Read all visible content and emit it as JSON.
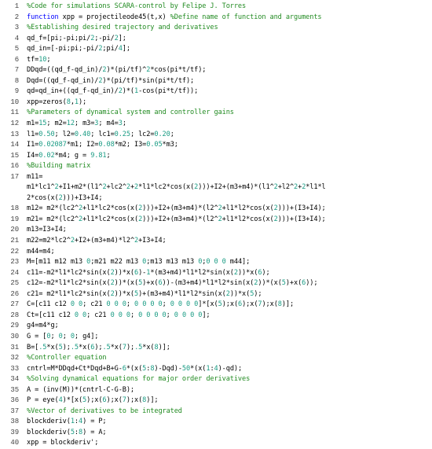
{
  "colors": {
    "comment": "#228B22",
    "keyword": "#0000FF",
    "number": "#1a9c84",
    "text": "#000000",
    "line_number": "#444444",
    "background": "#ffffff"
  },
  "lines": [
    {
      "n": "1",
      "segs": [
        {
          "t": "%Code for simulations SCARA-control by Felipe J. Torres",
          "c": "cmt"
        }
      ]
    },
    {
      "n": "2",
      "segs": [
        {
          "t": "function",
          "c": "kw"
        },
        {
          "t": " xpp = projectileode45(t,x) ",
          "c": "plain"
        },
        {
          "t": "%Define name of function and arguments",
          "c": "cmt"
        }
      ]
    },
    {
      "n": "3",
      "segs": [
        {
          "t": "%Establishing desired trajectory and derivatives",
          "c": "cmt"
        }
      ]
    },
    {
      "n": "4",
      "segs": [
        {
          "t": "qd_f=[pi;-pi;pi/",
          "c": "plain"
        },
        {
          "t": "2",
          "c": "num"
        },
        {
          "t": ";-pi/",
          "c": "plain"
        },
        {
          "t": "2",
          "c": "num"
        },
        {
          "t": "];",
          "c": "plain"
        }
      ]
    },
    {
      "n": "5",
      "segs": [
        {
          "t": "qd_in=[-pi;pi;-pi/",
          "c": "plain"
        },
        {
          "t": "2",
          "c": "num"
        },
        {
          "t": ";pi/",
          "c": "plain"
        },
        {
          "t": "4",
          "c": "num"
        },
        {
          "t": "];",
          "c": "plain"
        }
      ]
    },
    {
      "n": "6",
      "segs": [
        {
          "t": "tf=",
          "c": "plain"
        },
        {
          "t": "10",
          "c": "num"
        },
        {
          "t": ";",
          "c": "plain"
        }
      ]
    },
    {
      "n": "7",
      "segs": [
        {
          "t": "DDqd=((qd_f-qd_in)/",
          "c": "plain"
        },
        {
          "t": "2",
          "c": "num"
        },
        {
          "t": ")*(pi/tf)^",
          "c": "plain"
        },
        {
          "t": "2",
          "c": "num"
        },
        {
          "t": "*cos(pi*t/tf);",
          "c": "plain"
        }
      ]
    },
    {
      "n": "8",
      "segs": [
        {
          "t": "Dqd=((qd_f-qd_in)/",
          "c": "plain"
        },
        {
          "t": "2",
          "c": "num"
        },
        {
          "t": ")*(pi/tf)*sin(pi*t/tf);",
          "c": "plain"
        }
      ]
    },
    {
      "n": "9",
      "segs": [
        {
          "t": "qd=qd_in+((qd_f-qd_in)/",
          "c": "plain"
        },
        {
          "t": "2",
          "c": "num"
        },
        {
          "t": ")*(",
          "c": "plain"
        },
        {
          "t": "1",
          "c": "num"
        },
        {
          "t": "-cos(pi*t/tf));",
          "c": "plain"
        }
      ]
    },
    {
      "n": "10",
      "segs": [
        {
          "t": "xpp=zeros(",
          "c": "plain"
        },
        {
          "t": "8",
          "c": "num"
        },
        {
          "t": ",",
          "c": "plain"
        },
        {
          "t": "1",
          "c": "num"
        },
        {
          "t": ");",
          "c": "plain"
        }
      ]
    },
    {
      "n": "11",
      "segs": [
        {
          "t": "%Parameters of dynamical system and controller gains",
          "c": "cmt"
        }
      ]
    },
    {
      "n": "12",
      "segs": [
        {
          "t": "m1=",
          "c": "plain"
        },
        {
          "t": "15",
          "c": "num"
        },
        {
          "t": "; m2=",
          "c": "plain"
        },
        {
          "t": "12",
          "c": "num"
        },
        {
          "t": "; m3=",
          "c": "plain"
        },
        {
          "t": "3",
          "c": "num"
        },
        {
          "t": "; m4=",
          "c": "plain"
        },
        {
          "t": "3",
          "c": "num"
        },
        {
          "t": ";",
          "c": "plain"
        }
      ]
    },
    {
      "n": "13",
      "segs": [
        {
          "t": "l1=",
          "c": "plain"
        },
        {
          "t": "0.50",
          "c": "num"
        },
        {
          "t": "; l2=",
          "c": "plain"
        },
        {
          "t": "0.40",
          "c": "num"
        },
        {
          "t": "; lc1=",
          "c": "plain"
        },
        {
          "t": "0.25",
          "c": "num"
        },
        {
          "t": "; lc2=",
          "c": "plain"
        },
        {
          "t": "0.20",
          "c": "num"
        },
        {
          "t": ";",
          "c": "plain"
        }
      ]
    },
    {
      "n": "14",
      "segs": [
        {
          "t": "I1=",
          "c": "plain"
        },
        {
          "t": "0.02087",
          "c": "num"
        },
        {
          "t": "*m1; I2=",
          "c": "plain"
        },
        {
          "t": "0.08",
          "c": "num"
        },
        {
          "t": "*m2; I3=",
          "c": "plain"
        },
        {
          "t": "0.05",
          "c": "num"
        },
        {
          "t": "*m3;",
          "c": "plain"
        }
      ]
    },
    {
      "n": "15",
      "segs": [
        {
          "t": "I4=",
          "c": "plain"
        },
        {
          "t": "0.02",
          "c": "num"
        },
        {
          "t": "*m4; g = ",
          "c": "plain"
        },
        {
          "t": "9.81",
          "c": "num"
        },
        {
          "t": ";",
          "c": "plain"
        }
      ]
    },
    {
      "n": "16",
      "segs": [
        {
          "t": "%Building matrix",
          "c": "cmt"
        }
      ]
    },
    {
      "n": "17",
      "segs": [
        {
          "t": "m11=",
          "c": "plain"
        }
      ]
    },
    {
      "n": "",
      "segs": [
        {
          "t": "m1*lc1^",
          "c": "plain"
        },
        {
          "t": "2",
          "c": "num"
        },
        {
          "t": "+I1+m2*(l1^",
          "c": "plain"
        },
        {
          "t": "2",
          "c": "num"
        },
        {
          "t": "+lc2^",
          "c": "plain"
        },
        {
          "t": "2",
          "c": "num"
        },
        {
          "t": "+",
          "c": "plain"
        },
        {
          "t": "2",
          "c": "num"
        },
        {
          "t": "*l1*lc2*cos(x(",
          "c": "plain"
        },
        {
          "t": "2",
          "c": "num"
        },
        {
          "t": ")))+I2+(m3+m4)*(l1^",
          "c": "plain"
        },
        {
          "t": "2",
          "c": "num"
        },
        {
          "t": "+l2^",
          "c": "plain"
        },
        {
          "t": "2",
          "c": "num"
        },
        {
          "t": "+",
          "c": "plain"
        },
        {
          "t": "2",
          "c": "num"
        },
        {
          "t": "*l1*l",
          "c": "plain"
        }
      ]
    },
    {
      "n": "",
      "segs": [
        {
          "t": "2*cos(x(",
          "c": "plain"
        },
        {
          "t": "2",
          "c": "num"
        },
        {
          "t": ")))+I3+I4;",
          "c": "plain"
        }
      ]
    },
    {
      "n": "18",
      "segs": [
        {
          "t": "m12= m2*(lc2^",
          "c": "plain"
        },
        {
          "t": "2",
          "c": "num"
        },
        {
          "t": "+l1*lc2*cos(x(",
          "c": "plain"
        },
        {
          "t": "2",
          "c": "num"
        },
        {
          "t": ")))+I2+(m3+m4)*(l2^",
          "c": "plain"
        },
        {
          "t": "2",
          "c": "num"
        },
        {
          "t": "+l1*l2*cos(x(",
          "c": "plain"
        },
        {
          "t": "2",
          "c": "num"
        },
        {
          "t": ")))+(I3+I4);",
          "c": "plain"
        }
      ]
    },
    {
      "n": "19",
      "segs": [
        {
          "t": "m21= m2*(lc2^",
          "c": "plain"
        },
        {
          "t": "2",
          "c": "num"
        },
        {
          "t": "+l1*lc2*cos(x(",
          "c": "plain"
        },
        {
          "t": "2",
          "c": "num"
        },
        {
          "t": ")))+I2+(m3+m4)*(l2^",
          "c": "plain"
        },
        {
          "t": "2",
          "c": "num"
        },
        {
          "t": "+l1*l2*cos(x(",
          "c": "plain"
        },
        {
          "t": "2",
          "c": "num"
        },
        {
          "t": ")))+(I3+I4);",
          "c": "plain"
        }
      ]
    },
    {
      "n": "20",
      "segs": [
        {
          "t": "m13=I3+I4;",
          "c": "plain"
        }
      ]
    },
    {
      "n": "21",
      "segs": [
        {
          "t": "m22=m2*lc2^",
          "c": "plain"
        },
        {
          "t": "2",
          "c": "num"
        },
        {
          "t": "+I2+(m3+m4)*l2^",
          "c": "plain"
        },
        {
          "t": "2",
          "c": "num"
        },
        {
          "t": "+I3+I4;",
          "c": "plain"
        }
      ]
    },
    {
      "n": "22",
      "segs": [
        {
          "t": "m44=m4;",
          "c": "plain"
        }
      ]
    },
    {
      "n": "23",
      "segs": [
        {
          "t": "M=[m11 m12 m13 ",
          "c": "plain"
        },
        {
          "t": "0",
          "c": "num"
        },
        {
          "t": ";m21 m22 m13 ",
          "c": "plain"
        },
        {
          "t": "0",
          "c": "num"
        },
        {
          "t": ";m13 m13 m13 ",
          "c": "plain"
        },
        {
          "t": "0",
          "c": "num"
        },
        {
          "t": ";",
          "c": "plain"
        },
        {
          "t": "0 0 0",
          "c": "num"
        },
        {
          "t": " m44];",
          "c": "plain"
        }
      ]
    },
    {
      "n": "24",
      "segs": [
        {
          "t": "c11=-m2*l1*lc2*sin(x(",
          "c": "plain"
        },
        {
          "t": "2",
          "c": "num"
        },
        {
          "t": "))*x(",
          "c": "plain"
        },
        {
          "t": "6",
          "c": "num"
        },
        {
          "t": ")-",
          "c": "plain"
        },
        {
          "t": "1",
          "c": "num"
        },
        {
          "t": "*(m3+m4)*l1*l2*sin(x(",
          "c": "plain"
        },
        {
          "t": "2",
          "c": "num"
        },
        {
          "t": "))*x(",
          "c": "plain"
        },
        {
          "t": "6",
          "c": "num"
        },
        {
          "t": ");",
          "c": "plain"
        }
      ]
    },
    {
      "n": "25",
      "segs": [
        {
          "t": "c12=-m2*l1*lc2*sin(x(",
          "c": "plain"
        },
        {
          "t": "2",
          "c": "num"
        },
        {
          "t": "))*(x(",
          "c": "plain"
        },
        {
          "t": "5",
          "c": "num"
        },
        {
          "t": ")+x(",
          "c": "plain"
        },
        {
          "t": "6",
          "c": "num"
        },
        {
          "t": "))-(m3+m4)*l1*l2*sin(x(",
          "c": "plain"
        },
        {
          "t": "2",
          "c": "num"
        },
        {
          "t": "))*(x(",
          "c": "plain"
        },
        {
          "t": "5",
          "c": "num"
        },
        {
          "t": ")+x(",
          "c": "plain"
        },
        {
          "t": "6",
          "c": "num"
        },
        {
          "t": "));",
          "c": "plain"
        }
      ]
    },
    {
      "n": "26",
      "segs": [
        {
          "t": "c21= m2*l1*lc2*sin(x(",
          "c": "plain"
        },
        {
          "t": "2",
          "c": "num"
        },
        {
          "t": "))*x(",
          "c": "plain"
        },
        {
          "t": "5",
          "c": "num"
        },
        {
          "t": ")+(m3+m4)*l1*l2*sin(x(",
          "c": "plain"
        },
        {
          "t": "2",
          "c": "num"
        },
        {
          "t": "))*x(",
          "c": "plain"
        },
        {
          "t": "5",
          "c": "num"
        },
        {
          "t": ");",
          "c": "plain"
        }
      ]
    },
    {
      "n": "27",
      "segs": [
        {
          "t": "C=[c11 c12 ",
          "c": "plain"
        },
        {
          "t": "0 0",
          "c": "num"
        },
        {
          "t": "; c21 ",
          "c": "plain"
        },
        {
          "t": "0 0 0",
          "c": "num"
        },
        {
          "t": "; ",
          "c": "plain"
        },
        {
          "t": "0 0 0 0",
          "c": "num"
        },
        {
          "t": "; ",
          "c": "plain"
        },
        {
          "t": "0 0 0 0",
          "c": "num"
        },
        {
          "t": "]*[x(",
          "c": "plain"
        },
        {
          "t": "5",
          "c": "num"
        },
        {
          "t": ");x(",
          "c": "plain"
        },
        {
          "t": "6",
          "c": "num"
        },
        {
          "t": ");x(",
          "c": "plain"
        },
        {
          "t": "7",
          "c": "num"
        },
        {
          "t": ");x(",
          "c": "plain"
        },
        {
          "t": "8",
          "c": "num"
        },
        {
          "t": ")];",
          "c": "plain"
        }
      ]
    },
    {
      "n": "28",
      "segs": [
        {
          "t": "Ct=[c11 c12 ",
          "c": "plain"
        },
        {
          "t": "0 0",
          "c": "num"
        },
        {
          "t": "; c21 ",
          "c": "plain"
        },
        {
          "t": "0 0 0",
          "c": "num"
        },
        {
          "t": "; ",
          "c": "plain"
        },
        {
          "t": "0 0 0 0",
          "c": "num"
        },
        {
          "t": "; ",
          "c": "plain"
        },
        {
          "t": "0 0 0 0",
          "c": "num"
        },
        {
          "t": "];",
          "c": "plain"
        }
      ]
    },
    {
      "n": "29",
      "segs": [
        {
          "t": "g4=m4*g;",
          "c": "plain"
        }
      ]
    },
    {
      "n": "30",
      "segs": [
        {
          "t": "G = [",
          "c": "plain"
        },
        {
          "t": "0",
          "c": "num"
        },
        {
          "t": "; ",
          "c": "plain"
        },
        {
          "t": "0",
          "c": "num"
        },
        {
          "t": "; ",
          "c": "plain"
        },
        {
          "t": "0",
          "c": "num"
        },
        {
          "t": "; g4];",
          "c": "plain"
        }
      ]
    },
    {
      "n": "31",
      "segs": [
        {
          "t": "B=[",
          "c": "plain"
        },
        {
          "t": ".5",
          "c": "num"
        },
        {
          "t": "*x(",
          "c": "plain"
        },
        {
          "t": "5",
          "c": "num"
        },
        {
          "t": ");",
          "c": "plain"
        },
        {
          "t": ".5",
          "c": "num"
        },
        {
          "t": "*x(",
          "c": "plain"
        },
        {
          "t": "6",
          "c": "num"
        },
        {
          "t": ");",
          "c": "plain"
        },
        {
          "t": ".5",
          "c": "num"
        },
        {
          "t": "*x(",
          "c": "plain"
        },
        {
          "t": "7",
          "c": "num"
        },
        {
          "t": ");",
          "c": "plain"
        },
        {
          "t": ".5",
          "c": "num"
        },
        {
          "t": "*x(",
          "c": "plain"
        },
        {
          "t": "8",
          "c": "num"
        },
        {
          "t": ")];",
          "c": "plain"
        }
      ]
    },
    {
      "n": "32",
      "segs": [
        {
          "t": "%Controller equation",
          "c": "cmt"
        }
      ]
    },
    {
      "n": "33",
      "segs": [
        {
          "t": "cntrl=M*DDqd+Ct*Dqd+B+G-",
          "c": "plain"
        },
        {
          "t": "6",
          "c": "num"
        },
        {
          "t": "*(x(",
          "c": "plain"
        },
        {
          "t": "5",
          "c": "num"
        },
        {
          "t": ":",
          "c": "plain"
        },
        {
          "t": "8",
          "c": "num"
        },
        {
          "t": ")-Dqd)-",
          "c": "plain"
        },
        {
          "t": "50",
          "c": "num"
        },
        {
          "t": "*(x(",
          "c": "plain"
        },
        {
          "t": "1",
          "c": "num"
        },
        {
          "t": ":",
          "c": "plain"
        },
        {
          "t": "4",
          "c": "num"
        },
        {
          "t": ")-qd);",
          "c": "plain"
        }
      ]
    },
    {
      "n": "34",
      "segs": [
        {
          "t": "%Solving dynamical equations for major order derivatives",
          "c": "cmt"
        }
      ]
    },
    {
      "n": "35",
      "segs": [
        {
          "t": "A = (inv(M))*(cntrl-C-G-B);",
          "c": "plain"
        }
      ]
    },
    {
      "n": "36",
      "segs": [
        {
          "t": "P = eye(",
          "c": "plain"
        },
        {
          "t": "4",
          "c": "num"
        },
        {
          "t": ")*[x(",
          "c": "plain"
        },
        {
          "t": "5",
          "c": "num"
        },
        {
          "t": ");x(",
          "c": "plain"
        },
        {
          "t": "6",
          "c": "num"
        },
        {
          "t": ");x(",
          "c": "plain"
        },
        {
          "t": "7",
          "c": "num"
        },
        {
          "t": ");x(",
          "c": "plain"
        },
        {
          "t": "8",
          "c": "num"
        },
        {
          "t": ")];",
          "c": "plain"
        }
      ]
    },
    {
      "n": "37",
      "segs": [
        {
          "t": "%Vector of derivatives to be integrated",
          "c": "cmt"
        }
      ]
    },
    {
      "n": "38",
      "segs": [
        {
          "t": "blockderiv(",
          "c": "plain"
        },
        {
          "t": "1",
          "c": "num"
        },
        {
          "t": ":",
          "c": "plain"
        },
        {
          "t": "4",
          "c": "num"
        },
        {
          "t": ") = P;",
          "c": "plain"
        }
      ]
    },
    {
      "n": "39",
      "segs": [
        {
          "t": "blockderiv(",
          "c": "plain"
        },
        {
          "t": "5",
          "c": "num"
        },
        {
          "t": ":",
          "c": "plain"
        },
        {
          "t": "8",
          "c": "num"
        },
        {
          "t": ") = A;",
          "c": "plain"
        }
      ]
    },
    {
      "n": "40",
      "segs": [
        {
          "t": "xpp = blockderiv';",
          "c": "plain"
        }
      ]
    }
  ]
}
